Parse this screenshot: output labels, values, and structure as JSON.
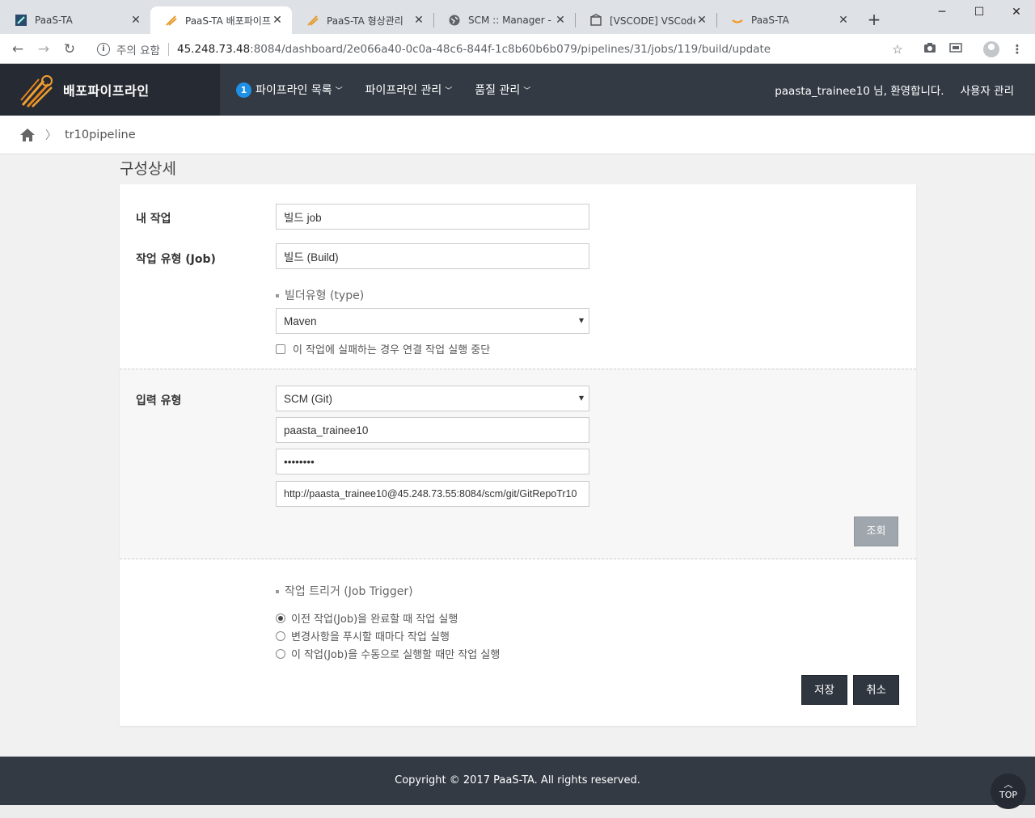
{
  "browser": {
    "tabs": [
      {
        "title": "PaaS-TA",
        "icon": "paasta-icon",
        "active": false
      },
      {
        "title": "PaaS-TA 배포파이프",
        "icon": "pipeline-icon",
        "active": true
      },
      {
        "title": "PaaS-TA 형상관리",
        "icon": "pipeline-icon",
        "active": false
      },
      {
        "title": "SCM :: Manager - Gi",
        "icon": "globe-icon",
        "active": false
      },
      {
        "title": "[VSCODE] VSCode에",
        "icon": "vscode-icon",
        "active": false
      },
      {
        "title": "PaaS-TA",
        "icon": "amazon-icon",
        "active": false
      }
    ],
    "address": {
      "security_label": "주의 요함",
      "host": "45.248.73.48",
      "path": ":8084/dashboard/2e066a40-0c0a-48c6-844f-1c8b60b6b079/pipelines/31/jobs/119/build/update"
    }
  },
  "header": {
    "brand": "배포파이프라인",
    "nav": [
      {
        "label": "파이프라인 목록",
        "badge": "1"
      },
      {
        "label": "파이프라인 관리"
      },
      {
        "label": "품질 관리"
      }
    ],
    "welcome": "paasta_trainee10 님, 환영합니다.",
    "user_admin": "사용자 관리"
  },
  "breadcrumb": {
    "current": "tr10pipeline"
  },
  "page_title": "구성상세",
  "form": {
    "my_job_label": "내 작업",
    "my_job_value": "빌드 job",
    "job_type_label": "작업 유형 (Job)",
    "job_type_value": "빌드 (Build)",
    "builder_type_heading": "빌더유형 (type)",
    "builder_type_value": "Maven",
    "stop_on_fail_label": "이 작업에 실패하는 경우 연결 작업 실행 중단",
    "input_type_label": "입력 유형",
    "input_type_value": "SCM (Git)",
    "scm_username": "paasta_trainee10",
    "scm_password": "••••••••",
    "scm_url": "http://paasta_trainee10@45.248.73.55:8084/scm/git/GitRepoTr10",
    "query_button": "조회",
    "trigger_heading": "작업 트리거 (Job Trigger)",
    "trigger_options": [
      {
        "label": "이전 작업(Job)을 완료할 때 작업 실행",
        "selected": true
      },
      {
        "label": "변경사항을 푸시할 때마다 작업 실행",
        "selected": false
      },
      {
        "label": "이 작업(Job)을 수동으로 실행할 때만 작업 실행",
        "selected": false
      }
    ],
    "save_button": "저장",
    "cancel_button": "취소"
  },
  "footer": {
    "copyright": "Copyright © 2017 PaaS-TA. All rights reserved."
  },
  "top_button": "TOP",
  "colors": {
    "header_bg": "#333a44",
    "brand_bg": "#262b33",
    "badge_blue": "#1e90e6",
    "accent_orange": "#f0a030"
  }
}
